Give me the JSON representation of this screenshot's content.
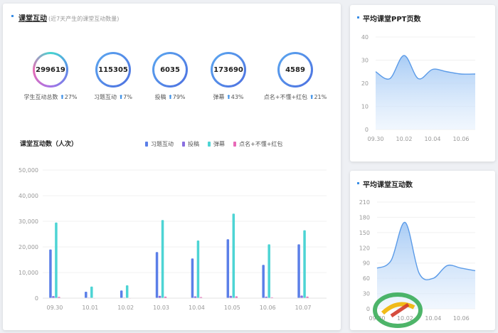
{
  "main": {
    "title": "课堂互动",
    "subtitle": "(近7天产生的课堂互动数量)",
    "stats": [
      {
        "value": "299619",
        "label": "学生互动总数",
        "change": "27%"
      },
      {
        "value": "115305",
        "label": "习题互动",
        "change": "7%"
      },
      {
        "value": "6035",
        "label": "投稿",
        "change": "79%"
      },
      {
        "value": "173690",
        "label": "弹幕",
        "change": "43%"
      },
      {
        "value": "4589",
        "label": "点名+不懂+红包",
        "change": "21%"
      }
    ],
    "arrow_glyph": "⬆",
    "chart_title": "课堂互动数（人次）"
  },
  "ppt": {
    "title": "平均课堂PPT页数"
  },
  "interaction": {
    "title": "平均课堂互动数"
  },
  "colors": {
    "accent": "#3a8ee6",
    "series_exercise": "#5b7fe8",
    "series_submission": "#8a6fe0",
    "series_danmu": "#4dd4d4",
    "series_rollcall": "#e86ab8"
  },
  "chart_data": [
    {
      "type": "bar",
      "title": "课堂互动数（人次）",
      "categories": [
        "09.30",
        "10.01",
        "10.02",
        "10.03",
        "10.04",
        "10.05",
        "10.06",
        "10.07"
      ],
      "ylim": [
        0,
        50000
      ],
      "yticks": [
        "0",
        "10,000",
        "20,000",
        "30,000",
        "40,000",
        "50,000"
      ],
      "legend_position": "top-right",
      "series": [
        {
          "name": "习题互动",
          "values": [
            19000,
            2500,
            3000,
            18000,
            15500,
            23000,
            13000,
            21000
          ]
        },
        {
          "name": "投稿",
          "values": [
            800,
            200,
            200,
            900,
            700,
            900,
            600,
            1000
          ]
        },
        {
          "name": "弹幕",
          "values": [
            29500,
            4500,
            5000,
            30500,
            22500,
            33000,
            21000,
            26500
          ]
        },
        {
          "name": "点名+不懂+红包",
          "values": [
            500,
            100,
            100,
            600,
            400,
            700,
            300,
            600
          ]
        }
      ]
    },
    {
      "type": "area",
      "title": "平均课堂PPT页数",
      "x": [
        "09.30",
        "10.01",
        "10.02",
        "10.03",
        "10.04",
        "10.05",
        "10.06",
        "10.07"
      ],
      "xticks": [
        "09.30",
        "10.02",
        "10.04",
        "10.06"
      ],
      "values": [
        25,
        22,
        32,
        22,
        26,
        25,
        24,
        24
      ],
      "ylim": [
        0,
        40
      ],
      "yticks": [
        "0",
        "10",
        "20",
        "30",
        "40"
      ]
    },
    {
      "type": "area",
      "title": "平均课堂互动数",
      "x": [
        "09.30",
        "10.01",
        "10.02",
        "10.03",
        "10.04",
        "10.05",
        "10.06",
        "10.07"
      ],
      "xticks": [
        "09.30",
        "10.02",
        "10.04",
        "10.06"
      ],
      "values": [
        80,
        95,
        170,
        70,
        60,
        85,
        80,
        75
      ],
      "ylim": [
        0,
        210
      ],
      "yticks": [
        "0",
        "30",
        "60",
        "90",
        "120",
        "150",
        "180",
        "210"
      ]
    }
  ]
}
